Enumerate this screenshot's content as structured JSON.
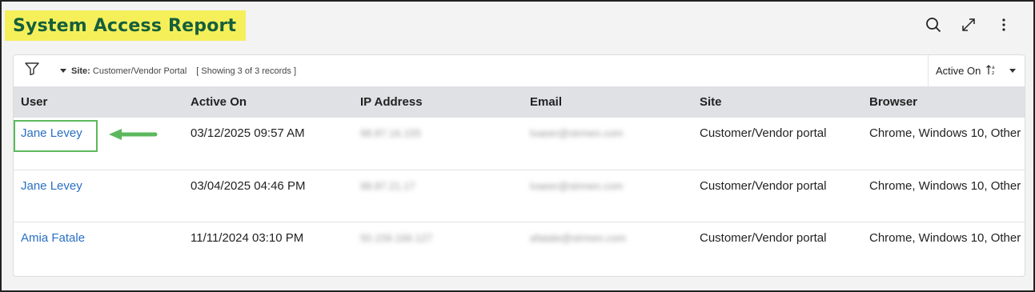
{
  "header": {
    "title": "System Access Report"
  },
  "icons": {
    "search": "search-icon",
    "expand": "expand-icon",
    "more": "more-vertical-icon",
    "filter": "filter-icon",
    "sort": "sort-icon"
  },
  "toolbar": {
    "site_label": "Site:",
    "site_value": "Customer/Vendor Portal",
    "records": "[ Showing 3 of 3 records ]",
    "sort_label": "Active On"
  },
  "table": {
    "columns": [
      "User",
      "Active On",
      "IP Address",
      "Email",
      "Site",
      "Browser"
    ],
    "rows": [
      {
        "user": "Jane Levey",
        "active_on": "03/12/2025 09:57 AM",
        "ip": "98.87.16.155",
        "email": "lvaeer@strmen.com",
        "site": "Customer/Vendor portal",
        "browser": "Chrome, Windows 10, Other"
      },
      {
        "user": "Jane Levey",
        "active_on": "03/04/2025 04:46 PM",
        "ip": "98.87.21.17",
        "email": "lvaeer@strmen.com",
        "site": "Customer/Vendor portal",
        "browser": "Chrome, Windows 10, Other"
      },
      {
        "user": "Amia Fatale",
        "active_on": "11/11/2024 03:10 PM",
        "ip": "50.159.166.127",
        "email": "afatale@strmen.com",
        "site": "Customer/Vendor portal",
        "browser": "Chrome, Windows 10, Other"
      }
    ]
  },
  "colors": {
    "title_bg": "#f5f05a",
    "title_text": "#165f3a",
    "link": "#2a6fc4",
    "highlight": "#5cb85c"
  }
}
